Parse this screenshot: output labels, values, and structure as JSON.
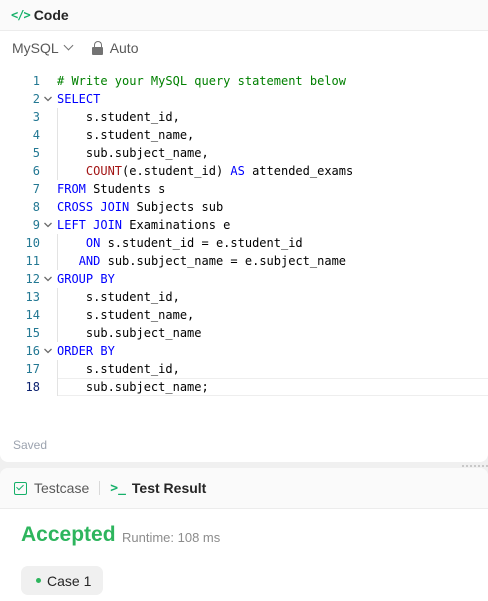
{
  "code_panel": {
    "title": "Code",
    "icon": "code-brackets-icon"
  },
  "toolbar": {
    "language": "MySQL",
    "mode": "Auto"
  },
  "editor": {
    "lines": [
      {
        "n": "1",
        "fold": false,
        "tokens": [
          {
            "t": "# Write your MySQL query statement below",
            "c": "cmt"
          }
        ]
      },
      {
        "n": "2",
        "fold": true,
        "tokens": [
          {
            "t": "SELECT",
            "c": "kw"
          }
        ]
      },
      {
        "n": "3",
        "fold": false,
        "tokens": [
          {
            "t": "    s.student_id,",
            "c": ""
          }
        ]
      },
      {
        "n": "4",
        "fold": false,
        "tokens": [
          {
            "t": "    s.student_name,",
            "c": ""
          }
        ]
      },
      {
        "n": "5",
        "fold": false,
        "tokens": [
          {
            "t": "    sub.subject_name,",
            "c": ""
          }
        ]
      },
      {
        "n": "6",
        "fold": false,
        "tokens": [
          {
            "t": "    ",
            "c": ""
          },
          {
            "t": "COUNT",
            "c": "fn"
          },
          {
            "t": "(e.student_id) ",
            "c": ""
          },
          {
            "t": "AS",
            "c": "kw"
          },
          {
            "t": " attended_exams",
            "c": ""
          }
        ]
      },
      {
        "n": "7",
        "fold": false,
        "tokens": [
          {
            "t": "FROM",
            "c": "kw"
          },
          {
            "t": " Students s",
            "c": ""
          }
        ]
      },
      {
        "n": "8",
        "fold": false,
        "tokens": [
          {
            "t": "CROSS JOIN",
            "c": "kw"
          },
          {
            "t": " Subjects sub",
            "c": ""
          }
        ]
      },
      {
        "n": "9",
        "fold": true,
        "tokens": [
          {
            "t": "LEFT JOIN",
            "c": "kw"
          },
          {
            "t": " Examinations e",
            "c": ""
          }
        ]
      },
      {
        "n": "10",
        "fold": false,
        "tokens": [
          {
            "t": "    ",
            "c": ""
          },
          {
            "t": "ON",
            "c": "kw"
          },
          {
            "t": " s.student_id = e.student_id",
            "c": ""
          }
        ]
      },
      {
        "n": "11",
        "fold": false,
        "tokens": [
          {
            "t": "   ",
            "c": ""
          },
          {
            "t": "AND",
            "c": "kw"
          },
          {
            "t": " sub.subject_name = e.subject_name",
            "c": ""
          }
        ]
      },
      {
        "n": "12",
        "fold": true,
        "tokens": [
          {
            "t": "GROUP BY",
            "c": "kw"
          }
        ]
      },
      {
        "n": "13",
        "fold": false,
        "tokens": [
          {
            "t": "    s.student_id,",
            "c": ""
          }
        ]
      },
      {
        "n": "14",
        "fold": false,
        "tokens": [
          {
            "t": "    s.student_name,",
            "c": ""
          }
        ]
      },
      {
        "n": "15",
        "fold": false,
        "tokens": [
          {
            "t": "    sub.subject_name",
            "c": ""
          }
        ]
      },
      {
        "n": "16",
        "fold": true,
        "tokens": [
          {
            "t": "ORDER BY",
            "c": "kw"
          }
        ]
      },
      {
        "n": "17",
        "fold": false,
        "tokens": [
          {
            "t": "    s.student_id,",
            "c": ""
          }
        ]
      },
      {
        "n": "18",
        "fold": false,
        "active": true,
        "tokens": [
          {
            "t": "    sub.subject_name;",
            "c": ""
          }
        ]
      }
    ]
  },
  "status": {
    "saved": "Saved"
  },
  "tabs": {
    "testcase": "Testcase",
    "test_result": "Test Result"
  },
  "result": {
    "verdict": "Accepted",
    "runtime": "Runtime: 108 ms",
    "case_label": "Case 1"
  },
  "colors": {
    "accent": "#2db55d",
    "keyword": "#0000ff",
    "comment": "#008000",
    "function": "#a31515",
    "line_number": "#237893"
  }
}
